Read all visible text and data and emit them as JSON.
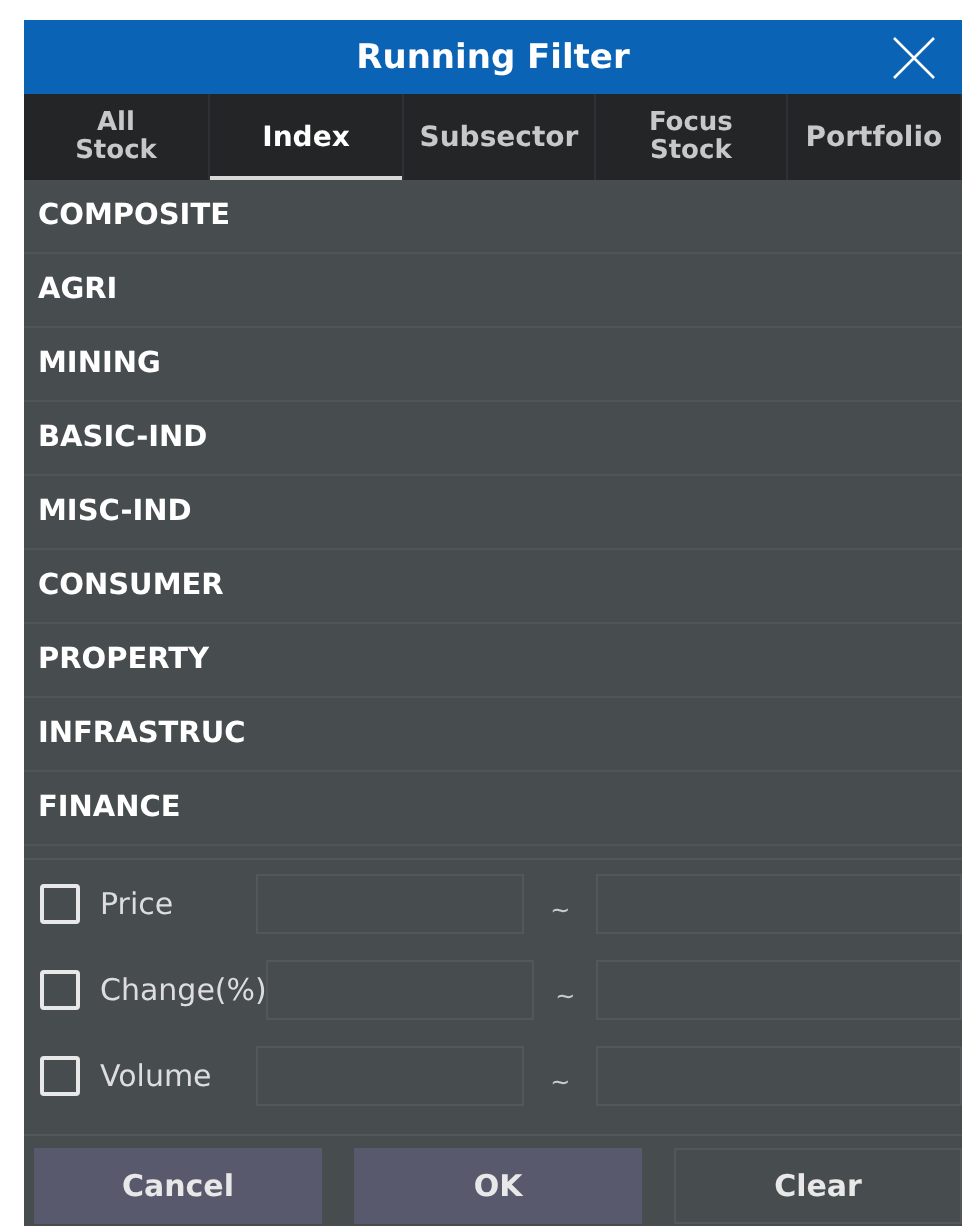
{
  "dialog": {
    "title": "Running Filter"
  },
  "tabs": [
    {
      "label": "All\nStock",
      "selected": false
    },
    {
      "label": "Index",
      "selected": true
    },
    {
      "label": "Subsector",
      "selected": false
    },
    {
      "label": "Focus\nStock",
      "selected": false
    },
    {
      "label": "Portfolio",
      "selected": false
    }
  ],
  "index_list": [
    "COMPOSITE",
    "AGRI",
    "MINING",
    "BASIC-IND",
    "MISC-IND",
    "CONSUMER",
    "PROPERTY",
    "INFRASTRUC",
    "FINANCE"
  ],
  "filters": [
    {
      "label": "Price",
      "checked": false,
      "separator": "~"
    },
    {
      "label": "Change(%)",
      "checked": false,
      "separator": "~"
    },
    {
      "label": "Volume",
      "checked": false,
      "separator": "~"
    }
  ],
  "buttons": [
    {
      "label": "Cancel",
      "kind": "filled"
    },
    {
      "label": "OK",
      "kind": "filled"
    },
    {
      "label": "Clear",
      "kind": "outline"
    }
  ]
}
